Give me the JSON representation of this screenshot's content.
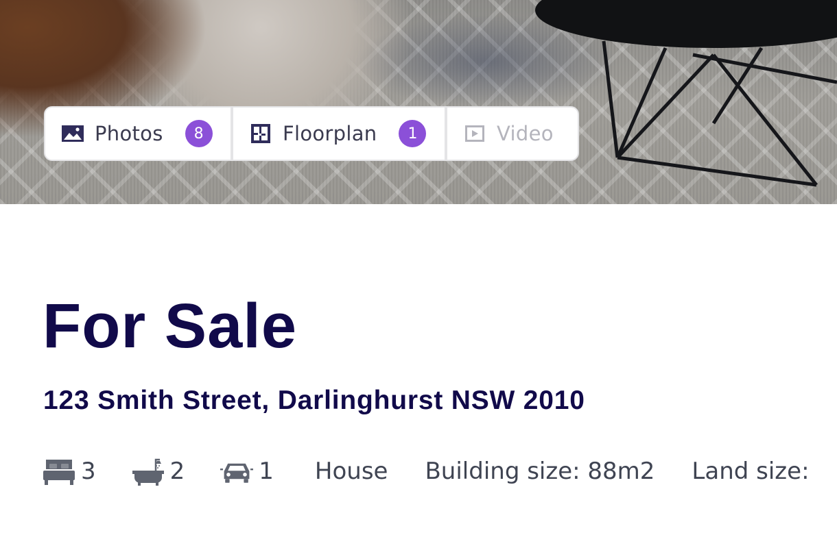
{
  "media_tabs": {
    "photos": {
      "label": "Photos",
      "count": "8",
      "icon": "image-icon"
    },
    "floorplan": {
      "label": "Floorplan",
      "count": "1",
      "icon": "floorplan-icon"
    },
    "video": {
      "label": "Video",
      "icon": "play-icon",
      "state": "disabled"
    }
  },
  "listing": {
    "status": "For Sale",
    "address": "123 Smith Street, Darlinghurst NSW 2010"
  },
  "features": {
    "bedrooms": {
      "icon": "bed-icon",
      "value": "3"
    },
    "bathrooms": {
      "icon": "bath-icon",
      "value": "2"
    },
    "car_spaces": {
      "icon": "car-icon",
      "value": "1"
    },
    "property_type": "House",
    "building_size": "Building size: 88m2",
    "land_size": "Land size:"
  },
  "colors": {
    "heading": "#110a4a",
    "badge": "#8b50d8",
    "feature_text": "#3f4452",
    "disabled_text": "#b4b4bc"
  }
}
